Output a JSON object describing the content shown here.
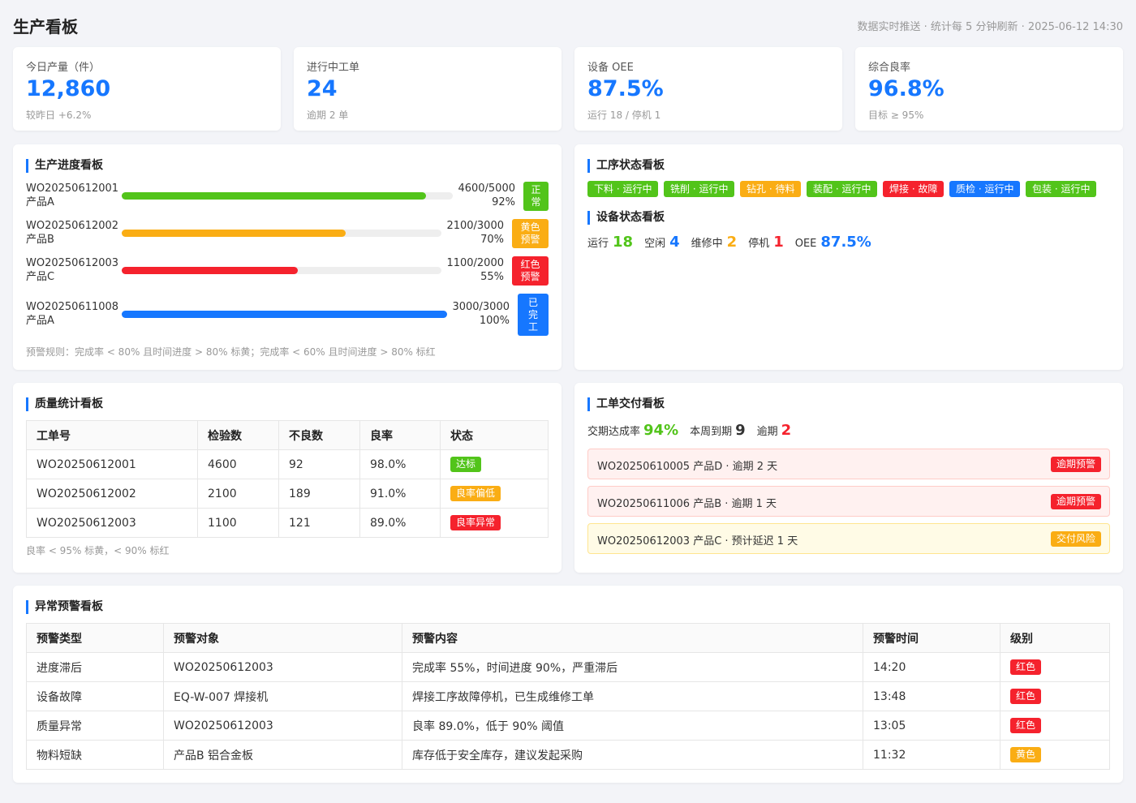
{
  "header": {
    "title": "生产看板",
    "subtitle": "数据实时推送 · 统计每 5 分钟刷新 · 2025-06-12 14:30"
  },
  "kpis": [
    {
      "label": "今日产量（件）",
      "value": "12,860",
      "sub": "较昨日 +6.2%"
    },
    {
      "label": "进行中工单",
      "value": "24",
      "sub": "逾期 2 单"
    },
    {
      "label": "设备 OEE",
      "value": "87.5%",
      "sub": "运行 18 / 停机 1"
    },
    {
      "label": "综合良率",
      "value": "96.8%",
      "sub": "目标 ≥ 95%"
    }
  ],
  "progress": {
    "title": "生产进度看板",
    "rows": [
      {
        "wo": "WO20250612001",
        "product": "产品A",
        "qty": "4600/5000",
        "pct": "92%",
        "fraction": 0.92,
        "status": "正常",
        "color": "#52c41a"
      },
      {
        "wo": "WO20250612002",
        "product": "产品B",
        "qty": "2100/3000",
        "pct": "70%",
        "fraction": 0.7,
        "status": "黄色预警",
        "color": "#faad14"
      },
      {
        "wo": "WO20250612003",
        "product": "产品C",
        "qty": "1100/2000",
        "pct": "55%",
        "fraction": 0.55,
        "status": "红色预警",
        "color": "#f5222d"
      },
      {
        "wo": "WO20250611008",
        "product": "产品A",
        "qty": "3000/3000",
        "pct": "100%",
        "fraction": 1.0,
        "status": "已完工",
        "color": "#1677ff"
      }
    ],
    "note": "预警规则：完成率 < 80% 且时间进度 > 80% 标黄；完成率 < 60% 且时间进度 > 80% 标红"
  },
  "process": {
    "title": "工序状态看板",
    "tags": [
      {
        "label": "下料 · 运行中",
        "color": "#52c41a"
      },
      {
        "label": "铣削 · 运行中",
        "color": "#52c41a"
      },
      {
        "label": "钻孔 · 待料",
        "color": "#faad14"
      },
      {
        "label": "装配 · 运行中",
        "color": "#52c41a"
      },
      {
        "label": "焊接 · 故障",
        "color": "#f5222d"
      },
      {
        "label": "质检 · 运行中",
        "color": "#1677ff"
      },
      {
        "label": "包装 · 运行中",
        "color": "#52c41a"
      }
    ]
  },
  "equipment": {
    "title": "设备状态看板",
    "running_label": "运行",
    "running": "18",
    "idle_label": "空闲",
    "idle": "4",
    "repair_label": "维修中",
    "repair": "2",
    "down_label": "停机",
    "down": "1",
    "oee_label": "OEE",
    "oee": "87.5%"
  },
  "quality": {
    "title": "质量统计看板",
    "headers": [
      "工单号",
      "检验数",
      "不良数",
      "良率",
      "状态"
    ],
    "rows": [
      {
        "wo": "WO20250612001",
        "inspected": "4600",
        "defects": "92",
        "rate": "98.0%",
        "status": "达标",
        "color": "#52c41a"
      },
      {
        "wo": "WO20250612002",
        "inspected": "2100",
        "defects": "189",
        "rate": "91.0%",
        "status": "良率偏低",
        "color": "#faad14"
      },
      {
        "wo": "WO20250612003",
        "inspected": "1100",
        "defects": "121",
        "rate": "89.0%",
        "status": "良率异常",
        "color": "#f5222d"
      }
    ],
    "note": "良率 < 95% 标黄，< 90% 标红"
  },
  "delivery": {
    "title": "工单交付看板",
    "rate_label": "交期达成率",
    "rate": "94%",
    "week_label": "本周到期",
    "week": "9",
    "overdue_label": "逾期",
    "overdue": "2",
    "alerts": [
      {
        "text": "WO20250610005 产品D · 逾期 2 天",
        "badge": "逾期预警",
        "badge_color": "#f5222d",
        "bg": "#fff1f0",
        "border": "#ffccc7"
      },
      {
        "text": "WO20250611006 产品B · 逾期 1 天",
        "badge": "逾期预警",
        "badge_color": "#f5222d",
        "bg": "#fff1f0",
        "border": "#ffccc7"
      },
      {
        "text": "WO20250612003 产品C · 预计延迟 1 天",
        "badge": "交付风险",
        "badge_color": "#faad14",
        "bg": "#fffbe6",
        "border": "#ffe58f"
      }
    ]
  },
  "exceptions": {
    "title": "异常预警看板",
    "headers": [
      "预警类型",
      "预警对象",
      "预警内容",
      "预警时间",
      "级别"
    ],
    "rows": [
      {
        "type": "进度滞后",
        "target": "WO20250612003",
        "content": "完成率 55%，时间进度 90%，严重滞后",
        "time": "14:20",
        "level": "红色",
        "color": "#f5222d"
      },
      {
        "type": "设备故障",
        "target": "EQ-W-007 焊接机",
        "content": "焊接工序故障停机，已生成维修工单",
        "time": "13:48",
        "level": "红色",
        "color": "#f5222d"
      },
      {
        "type": "质量异常",
        "target": "WO20250612003",
        "content": "良率 89.0%，低于 90% 阈值",
        "time": "13:05",
        "level": "红色",
        "color": "#f5222d"
      },
      {
        "type": "物料短缺",
        "target": "产品B 铝合金板",
        "content": "库存低于安全库存，建议发起采购",
        "time": "11:32",
        "level": "黄色",
        "color": "#faad14"
      }
    ]
  }
}
